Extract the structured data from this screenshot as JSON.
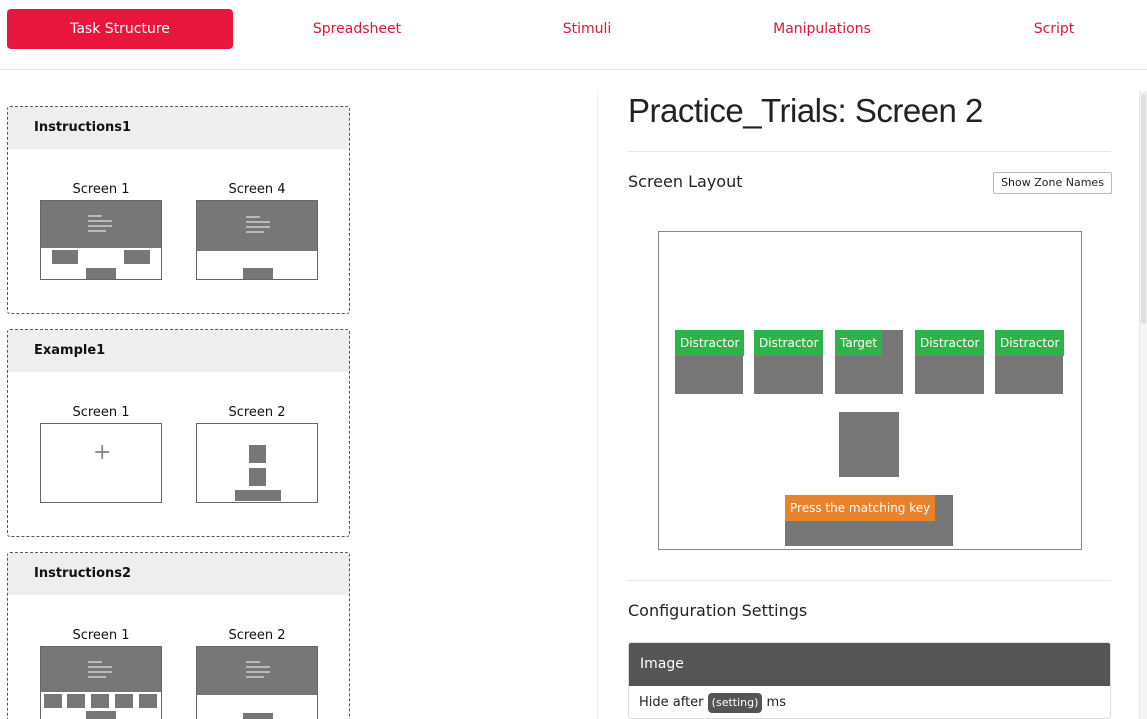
{
  "nav": {
    "tabs": [
      {
        "label": "Task Structure",
        "active": true
      },
      {
        "label": "Spreadsheet",
        "active": false
      },
      {
        "label": "Stimuli",
        "active": false
      },
      {
        "label": "Manipulations",
        "active": false
      },
      {
        "label": "Script",
        "active": false
      }
    ],
    "accent_color": "#e8163c"
  },
  "task_structure": {
    "blocks": [
      {
        "name": "Instructions1",
        "screens": [
          "Screen 1",
          "Screen 4"
        ]
      },
      {
        "name": "Example1",
        "screens": [
          "Screen 1",
          "Screen 2"
        ]
      },
      {
        "name": "Instructions2",
        "screens": [
          "Screen 1",
          "Screen 2"
        ]
      }
    ]
  },
  "editor": {
    "title": "Practice_Trials: Screen 2",
    "screen_layout": {
      "heading": "Screen Layout",
      "show_zone_names_label": "Show Zone Names",
      "zones": [
        {
          "label": "Distractor",
          "color": "#2eb34a"
        },
        {
          "label": "Distractor",
          "color": "#2eb34a"
        },
        {
          "label": "Target",
          "color": "#2eb34a"
        },
        {
          "label": "Distractor",
          "color": "#2eb34a"
        },
        {
          "label": "Distractor",
          "color": "#2eb34a"
        },
        {
          "label": "Press the matching key",
          "color": "#e8832c"
        }
      ]
    },
    "configuration": {
      "heading": "Configuration Settings",
      "panel_title": "Image",
      "row": {
        "prefix": "Hide after",
        "setting": "(setting)",
        "suffix": "ms"
      }
    }
  }
}
